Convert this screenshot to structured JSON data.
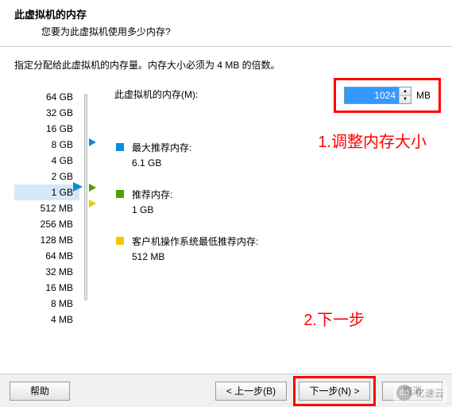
{
  "header": {
    "title": "此虚拟机的内存",
    "subtitle": "您要为此虚拟机使用多少内存?"
  },
  "instruction": "指定分配给此虚拟机的内存量。内存大小必须为 4 MB 的倍数。",
  "memory": {
    "label": "此虚拟机的内存(M):",
    "value": "1024",
    "unit": "MB"
  },
  "scale": [
    "64 GB",
    "32 GB",
    "16 GB",
    "8 GB",
    "4 GB",
    "2 GB",
    "1 GB",
    "512 MB",
    "256 MB",
    "128 MB",
    "64 MB",
    "32 MB",
    "16 MB",
    "8 MB",
    "4 MB"
  ],
  "selected_scale_index": 6,
  "recommendations": [
    {
      "color": "blue",
      "label": "最大推荐内存:",
      "value": "6.1 GB"
    },
    {
      "color": "green",
      "label": "推荐内存:",
      "value": "1 GB"
    },
    {
      "color": "yellow",
      "label": "客户机操作系统最低推荐内存:",
      "value": "512 MB"
    }
  ],
  "annotations": {
    "a1": "1.调整内存大小",
    "a2": "2.下一步"
  },
  "buttons": {
    "help": "帮助",
    "back": "< 上一步(B)",
    "next": "下一步(N) >",
    "cancel": "取消"
  },
  "watermark": "亿速云"
}
